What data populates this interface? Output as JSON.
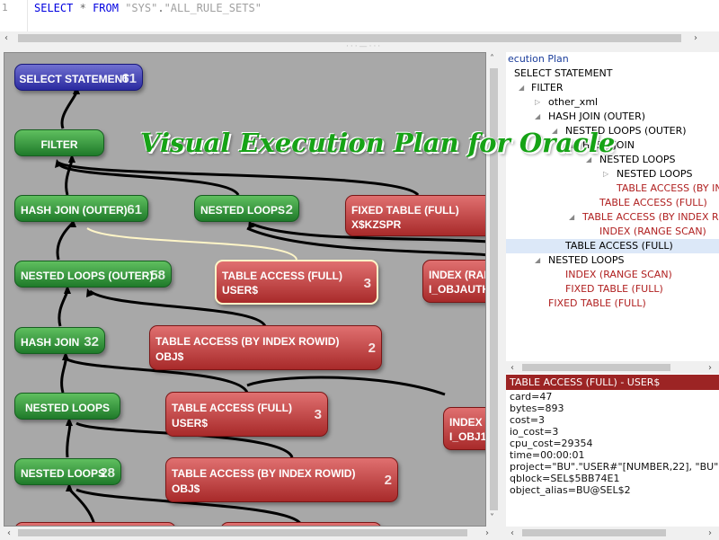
{
  "editor": {
    "line_number": "1",
    "sql": {
      "kw1": "SELECT",
      "star": "*",
      "kw2": "FROM",
      "schema": "\"SYS\"",
      "dot": ".",
      "table": "\"ALL_RULE_SETS\""
    }
  },
  "overlay_title": "Visual Execution Plan for Oracle",
  "diagram": {
    "nodes": [
      {
        "label": "SELECT STATEMENT",
        "cost": "61",
        "color": "blue"
      },
      {
        "label": "FILTER",
        "cost": "",
        "color": "green"
      },
      {
        "label": "HASH JOIN (OUTER)",
        "cost": "61",
        "color": "green"
      },
      {
        "label": "NESTED LOOPS",
        "cost": "2",
        "color": "green"
      },
      {
        "label": "FIXED TABLE (FULL)",
        "sub": "X$KZSPR",
        "cost": "",
        "color": "red"
      },
      {
        "label": "NESTED LOOPS (OUTER)",
        "cost": "58",
        "color": "green"
      },
      {
        "label": "TABLE ACCESS (FULL)",
        "sub": "USER$",
        "cost": "3",
        "color": "red"
      },
      {
        "label": "INDEX (RAN",
        "sub": "I_OBJAUTH",
        "cost": "",
        "color": "red"
      },
      {
        "label": "HASH JOIN",
        "cost": "32",
        "color": "green"
      },
      {
        "label": "TABLE ACCESS (BY INDEX ROWID)",
        "sub": "OBJ$",
        "cost": "2",
        "color": "red"
      },
      {
        "label": "NESTED LOOPS",
        "cost": "",
        "color": "green"
      },
      {
        "label": "TABLE ACCESS (FULL)",
        "sub": "USER$",
        "cost": "3",
        "color": "red"
      },
      {
        "label": "INDEX",
        "sub": "I_OBJ1",
        "cost": "",
        "color": "red"
      },
      {
        "label": "NESTED LOOPS",
        "cost": "28",
        "color": "green"
      },
      {
        "label": "TABLE ACCESS (BY INDEX ROWID)",
        "sub": "OBJ$",
        "cost": "2",
        "color": "red"
      }
    ]
  },
  "tree": {
    "header": "ecution Plan",
    "items": [
      {
        "label": "SELECT STATEMENT",
        "color": "black"
      },
      {
        "label": "FILTER",
        "color": "black"
      },
      {
        "label": "other_xml",
        "color": "black"
      },
      {
        "label": "HASH JOIN (OUTER)",
        "color": "black"
      },
      {
        "label": "NESTED LOOPS (OUTER)",
        "color": "black"
      },
      {
        "label": "HASH JOIN",
        "color": "black"
      },
      {
        "label": "NESTED LOOPS",
        "color": "black"
      },
      {
        "label": "NESTED LOOPS",
        "color": "black"
      },
      {
        "label": "TABLE ACCESS (BY INDE",
        "color": "red"
      },
      {
        "label": "TABLE ACCESS (FULL)",
        "color": "red"
      },
      {
        "label": "TABLE ACCESS (BY INDEX ROW",
        "color": "red"
      },
      {
        "label": "INDEX (RANGE SCAN)",
        "color": "red"
      },
      {
        "label": "TABLE ACCESS (FULL)",
        "color": "black"
      },
      {
        "label": "NESTED LOOPS",
        "color": "black"
      },
      {
        "label": "INDEX (RANGE SCAN)",
        "color": "red"
      },
      {
        "label": "FIXED TABLE (FULL)",
        "color": "red"
      },
      {
        "label": "FIXED TABLE (FULL)",
        "color": "red"
      }
    ]
  },
  "properties": {
    "header": "TABLE ACCESS (FULL) - USER$",
    "rows": [
      "card=47",
      "bytes=893",
      "cost=3",
      "io_cost=3",
      "cpu_cost=29354",
      "time=00:00:01",
      "project=\"BU\".\"USER#\"[NUMBER,22], \"BU\".",
      "qblock=SEL$5BB74E1",
      "object_alias=BU@SEL$2"
    ]
  },
  "colors": {
    "accent_green": "#16a316",
    "red_node": "#a82a2a",
    "green_node": "#1f7a2a",
    "blue_node": "#2a2aa0"
  }
}
